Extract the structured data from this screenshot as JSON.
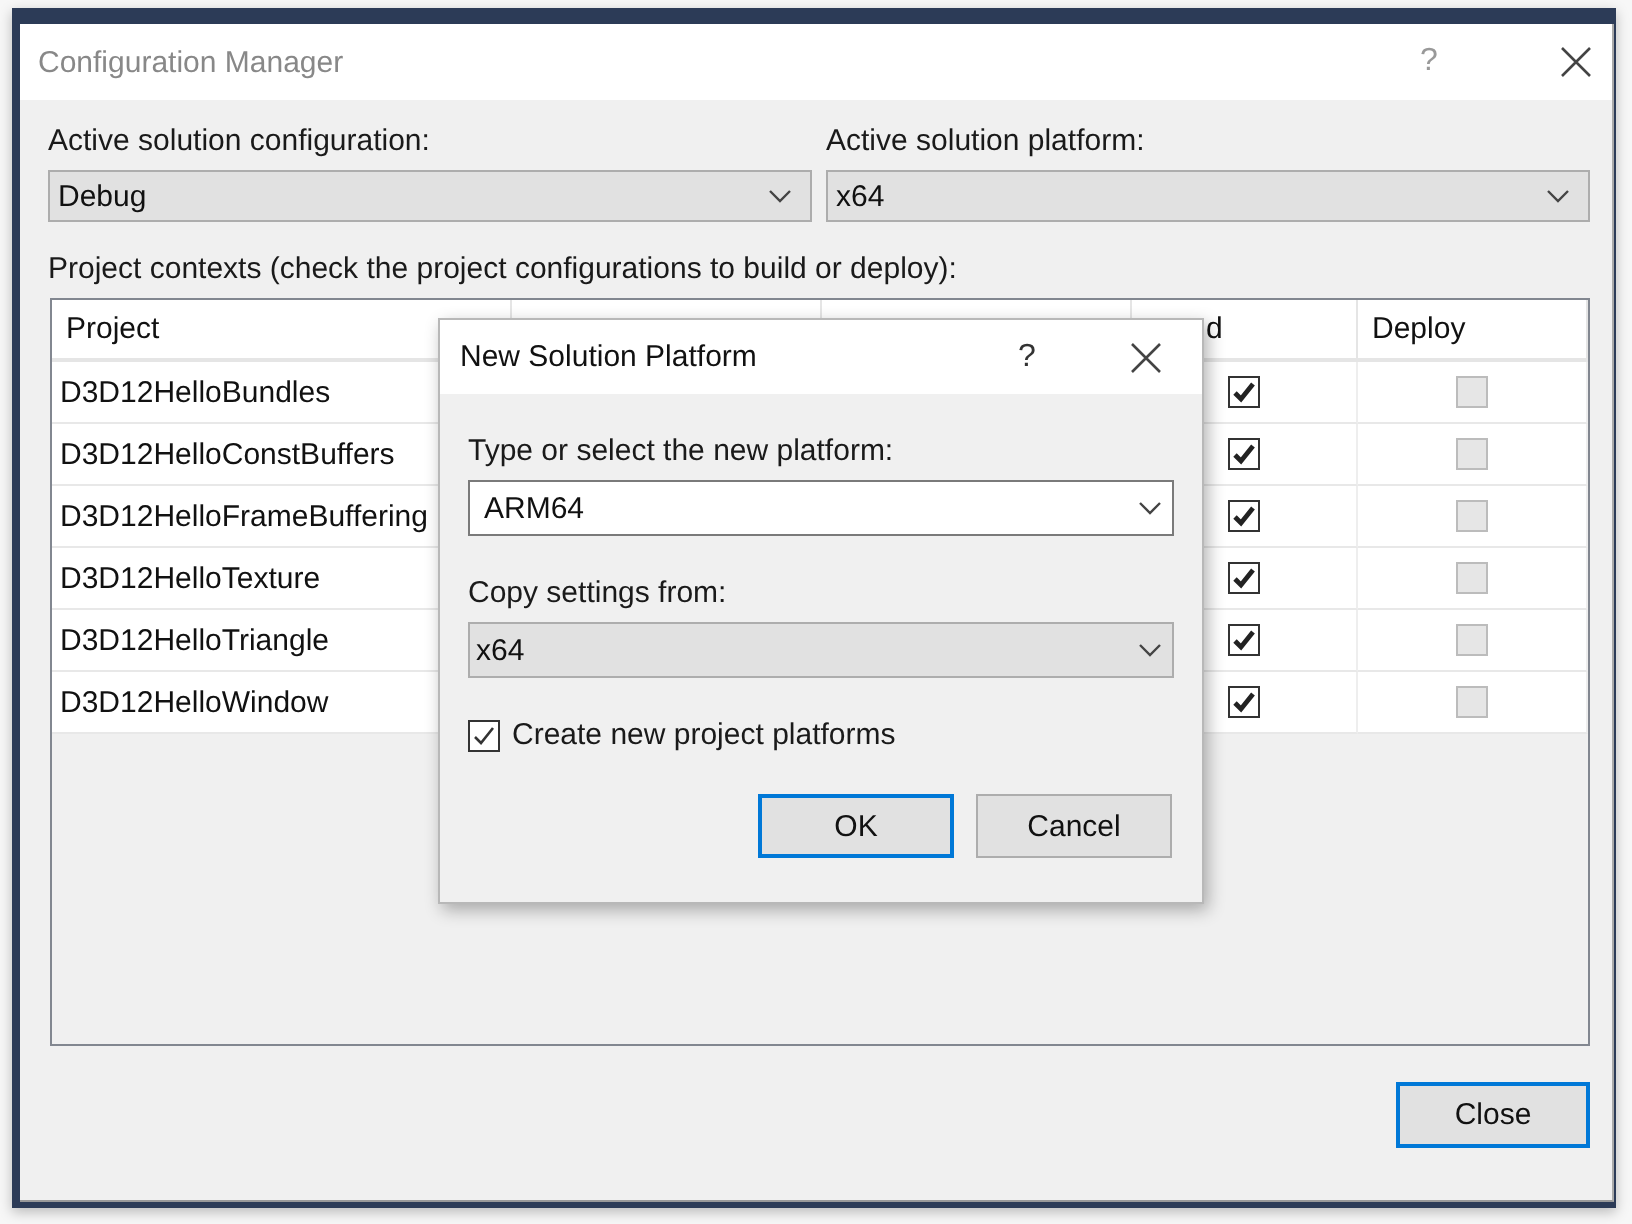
{
  "window": {
    "title": "Configuration Manager",
    "help": "?"
  },
  "active_configuration": {
    "label": "Active solution configuration:",
    "value": "Debug"
  },
  "active_platform": {
    "label": "Active solution platform:",
    "value": "x64"
  },
  "contexts_label": "Project contexts (check the project configurations to build or deploy):",
  "table": {
    "columns": [
      {
        "label": "Project"
      },
      {},
      {},
      {
        "label": "d"
      },
      {
        "label": "Deploy"
      }
    ],
    "rows": [
      {
        "project": "D3D12HelloBundles",
        "build": true,
        "deploy": false,
        "deploy_disabled": true
      },
      {
        "project": "D3D12HelloConstBuffers",
        "build": true,
        "deploy": false,
        "deploy_disabled": true
      },
      {
        "project": "D3D12HelloFrameBuffering",
        "build": true,
        "deploy": false,
        "deploy_disabled": true
      },
      {
        "project": "D3D12HelloTexture",
        "build": true,
        "deploy": false,
        "deploy_disabled": true
      },
      {
        "project": "D3D12HelloTriangle",
        "build": true,
        "deploy": false,
        "deploy_disabled": true
      },
      {
        "project": "D3D12HelloWindow",
        "build": true,
        "deploy": false,
        "deploy_disabled": true
      }
    ]
  },
  "close_button": "Close",
  "dialog": {
    "title": "New Solution Platform",
    "help": "?",
    "platform_label": "Type or select the new platform:",
    "platform_value": "ARM64",
    "copy_label": "Copy settings from:",
    "copy_value": "x64",
    "create_checkbox": {
      "label": "Create new project platforms",
      "checked": true
    },
    "buttons": [
      {
        "label": "OK",
        "default": true
      },
      {
        "label": "Cancel",
        "default": false
      }
    ]
  }
}
